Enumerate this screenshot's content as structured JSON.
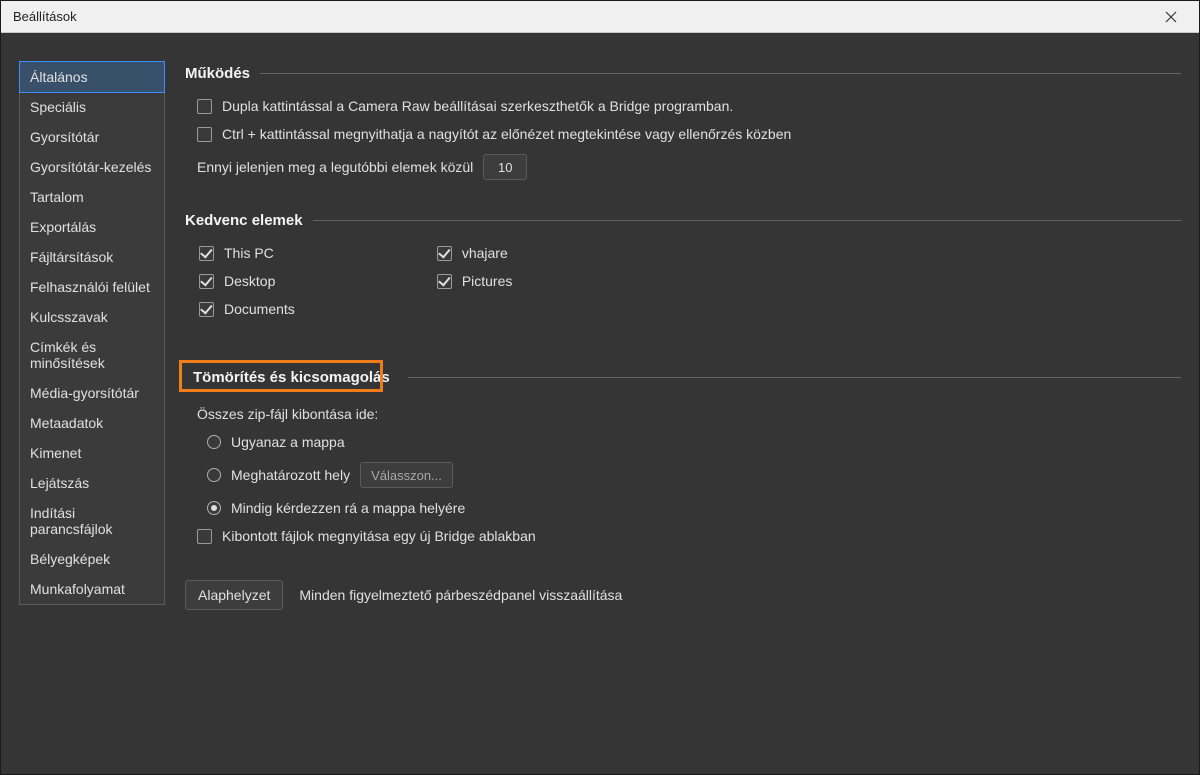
{
  "window": {
    "title": "Beállítások"
  },
  "sidebar": {
    "items": [
      "Általános",
      "Speciális",
      "Gyorsítótár",
      "Gyorsítótár-kezelés",
      "Tartalom",
      "Exportálás",
      "Fájltársítások",
      "Felhasználói felület",
      "Kulcsszavak",
      "Címkék és minősítések",
      "Média-gyorsítótár",
      "Metaadatok",
      "Kimenet",
      "Lejátszás",
      "Indítási parancsfájlok",
      "Bélyegképek",
      "Munkafolyamat"
    ],
    "active_index": 0
  },
  "section1": {
    "title": "Működés",
    "opt1": "Dupla kattintással a Camera Raw beállításai szerkeszthetők a Bridge programban.",
    "opt2": "Ctrl + kattintással megnyithatja a nagyítót az előnézet megtekintése vagy ellenőrzés közben",
    "recent_label": "Ennyi jelenjen meg a legutóbbi elemek közül",
    "recent_value": "10"
  },
  "section2": {
    "title": "Kedvenc elemek",
    "left": [
      "This PC",
      "Desktop",
      "Documents"
    ],
    "right": [
      "vhajare",
      "Pictures"
    ]
  },
  "section3": {
    "title": "Tömörítés és kicsomagolás",
    "extract_label": "Összes zip-fájl kibontása ide:",
    "r1": "Ugyanaz a mappa",
    "r2": "Meghatározott hely",
    "choose": "Válasszon...",
    "r3": "Mindig kérdezzen rá a mappa helyére",
    "open_new": "Kibontott fájlok megnyitása egy új Bridge ablakban"
  },
  "footer": {
    "reset": "Alaphelyzet",
    "reset_desc": "Minden figyelmeztető párbeszédpanel visszaállítása"
  }
}
